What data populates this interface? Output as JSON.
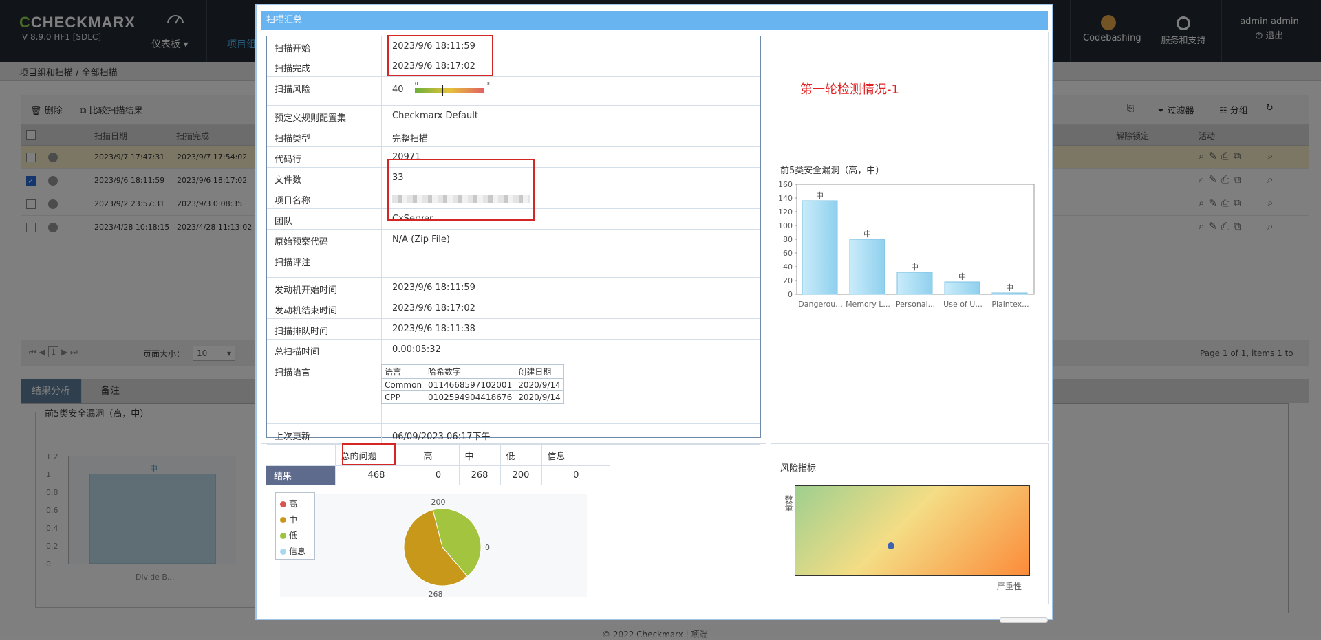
{
  "app": {
    "logo": "CHECKMARX",
    "version": "V 8.9.0 HF1  [SDLC]",
    "nav_dashboard": "仪表板",
    "nav_projects": "项目组",
    "nav_codebashing": "Codebashing",
    "nav_support": "服务和支持",
    "user_name": "admin admin",
    "logout": "退出"
  },
  "breadcrumb": "项目组和扫描 / 全部扫描",
  "toolbar": {
    "delete": "删除",
    "compare": "比较扫描结果",
    "filter": "过滤器",
    "group": "分组"
  },
  "grid": {
    "headers": [
      "扫描日期",
      "扫描完成",
      "解除锁定",
      "活动"
    ],
    "rows": [
      {
        "start": "2023/9/7 17:47:31",
        "end": "2023/9/7 17:54:02",
        "checked": false,
        "selected": true
      },
      {
        "start": "2023/9/6 18:11:59",
        "end": "2023/9/6 18:17:02",
        "checked": true,
        "selected": false
      },
      {
        "start": "2023/9/2 23:57:31",
        "end": "2023/9/3 0:08:35",
        "checked": false,
        "selected": false
      },
      {
        "start": "2023/4/28 10:18:15",
        "end": "2023/4/28 11:13:02",
        "checked": false,
        "selected": false
      }
    ],
    "page": "1",
    "page_size_label": "页面大小：",
    "page_size": "10",
    "page_info": "Page 1 of 1, items 1 to"
  },
  "bottom_tabs": [
    "结果分析",
    "备注"
  ],
  "bottom_chart": {
    "title": "前5类安全漏洞（高，中）",
    "bar_label": "中",
    "category": "Divide B...",
    "ticks": [
      "1.2",
      "1",
      "0.8",
      "0.6",
      "0.4",
      "0.2",
      "0"
    ]
  },
  "footer": "© 2022 Checkmarx | 项端",
  "modal": {
    "title": "扫描汇总",
    "annotation": "第一轮检测情况-1",
    "summary": [
      {
        "label": "扫描开始",
        "value": "2023/9/6 18:11:59"
      },
      {
        "label": "扫描完成",
        "value": "2023/9/6 18:17:02"
      },
      {
        "label": "扫描风险",
        "value": "40"
      },
      {
        "label": "预定义规则配置集",
        "value": "Checkmarx Default"
      },
      {
        "label": "扫描类型",
        "value": "完整扫描"
      },
      {
        "label": "代码行",
        "value": "20971"
      },
      {
        "label": "文件数",
        "value": "33"
      },
      {
        "label": "项目名称",
        "value": ""
      },
      {
        "label": "团队",
        "value": "CxServer"
      },
      {
        "label": "原始预案代码",
        "value": "N/A (Zip File)"
      },
      {
        "label": "扫描评注",
        "value": ""
      },
      {
        "label": "发动机开始时间",
        "value": "2023/9/6 18:11:59"
      },
      {
        "label": "发动机结束时间",
        "value": "2023/9/6 18:17:02"
      },
      {
        "label": "扫描排队时间",
        "value": "2023/9/6 18:11:38"
      },
      {
        "label": "总扫描时间",
        "value": "0.00:05:32"
      },
      {
        "label": "扫描语言",
        "value": ""
      },
      {
        "label": "上次更新",
        "value": "06/09/2023 06:17下午"
      }
    ],
    "risk_scale": {
      "min": "0",
      "max": "100",
      "value": 40
    },
    "languages": {
      "headers": [
        "语言",
        "哈希数字",
        "创建日期"
      ],
      "rows": [
        [
          "Common",
          "0114668597102001",
          "2020/9/14"
        ],
        [
          "CPP",
          "0102594904418676",
          "2020/9/14"
        ]
      ]
    },
    "results": {
      "headers": [
        "总的问题",
        "高",
        "中",
        "低",
        "信息"
      ],
      "row_label": "结果",
      "values": [
        "468",
        "0",
        "268",
        "200",
        "0"
      ]
    },
    "legend": [
      {
        "label": "高",
        "color": "#d9534f"
      },
      {
        "label": "中",
        "color": "#c8981a"
      },
      {
        "label": "低",
        "color": "#9bc53d"
      },
      {
        "label": "信息",
        "color": "#a8d8f0"
      }
    ],
    "risk_panel": {
      "title": "风险指标",
      "ylabel": "数量",
      "xlabel": "严重性"
    }
  },
  "chart_data": [
    {
      "type": "bar",
      "title": "前5类安全漏洞（高，中）",
      "categories": [
        "Dangerou...",
        "Memory L...",
        "Personal...",
        "Use of U...",
        "Plaintex..."
      ],
      "values": [
        136,
        80,
        32,
        18,
        2
      ],
      "labels": [
        "中",
        "中",
        "中",
        "中",
        "中"
      ],
      "ylim": [
        0,
        160
      ],
      "yticks": [
        "0",
        "20",
        "40",
        "60",
        "80",
        "100",
        "120",
        "140",
        "160"
      ]
    },
    {
      "type": "pie",
      "slices": [
        {
          "name": "中",
          "value": 268,
          "color": "#c8981a"
        },
        {
          "name": "低",
          "value": 200,
          "color": "#a3c43e"
        },
        {
          "name": "高",
          "value": 0,
          "color": "#d9534f"
        },
        {
          "name": "信息",
          "value": 0,
          "color": "#a8d8f0"
        }
      ],
      "data_labels": [
        "268",
        "200",
        "0"
      ]
    }
  ]
}
